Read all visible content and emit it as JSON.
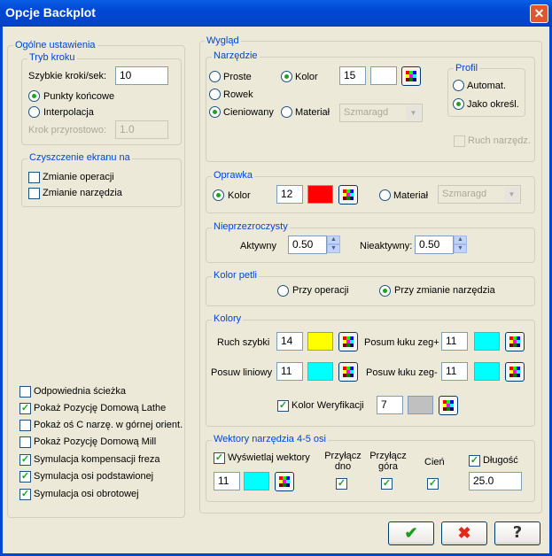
{
  "window": {
    "title": "Opcje Backplot"
  },
  "general": {
    "legend": "Ogólne ustawienia",
    "step_mode": {
      "legend": "Tryb kroku",
      "fast_steps_label": "Szybkie kroki/sek:",
      "fast_steps_value": "10",
      "endpoints_label": "Punkty końcowe",
      "interpolation_label": "Interpolacja",
      "increment_label": "Krok przyrostowo:",
      "increment_value": "1.0"
    },
    "clear_screen": {
      "legend": "Czyszczenie ekranu na",
      "op_change": "Zmianie operacji",
      "tool_change": "Zmianie narzędzia"
    },
    "options": [
      {
        "label": "Odpowiednia ścieżka",
        "checked": false
      },
      {
        "label": "Pokaż Pozycję Domową Lathe",
        "checked": true
      },
      {
        "label": "Pokaż oś C narzę. w górnej orient.",
        "checked": false
      },
      {
        "label": "Pokaż Pozycję Domową Mill",
        "checked": false
      },
      {
        "label": "Symulacja kompensacji freza",
        "checked": true
      },
      {
        "label": "Symulacja osi podstawionej",
        "checked": true
      },
      {
        "label": "Symulacja osi obrotowej",
        "checked": true
      }
    ]
  },
  "appearance": {
    "legend": "Wygląd",
    "tool": {
      "legend": "Narzędzie",
      "plain": "Proste",
      "line": "Rowek",
      "shaded": "Cieniowany",
      "color_label": "Kolor",
      "color_value": "15",
      "material_label": "Materiał",
      "material_value": "Szmaragd",
      "profile": {
        "legend": "Profil",
        "auto": "Automat.",
        "as_defined": "Jako określ."
      },
      "tool_motion": "Ruch narzędz."
    },
    "holder": {
      "legend": "Oprawka",
      "color_label": "Kolor",
      "color_value": "12",
      "material_label": "Materiał",
      "material_value": "Szmaragd"
    },
    "opacity": {
      "legend": "Nieprzezroczysty",
      "active_label": "Aktywny",
      "active_value": "0.50",
      "inactive_label": "Nieaktywny:",
      "inactive_value": "0.50"
    },
    "loop_color": {
      "legend": "Kolor petli",
      "per_op": "Przy operacji",
      "per_tool": "Przy zmianie narzędzia"
    },
    "colors": {
      "legend": "Kolory",
      "rapid_label": "Ruch szybki",
      "rapid_value": "14",
      "arc_cw_label": "Posum łuku zeg+",
      "arc_cw_value": "11",
      "linear_label": "Posuw liniowy",
      "linear_value": "11",
      "arc_ccw_label": "Posuw łuku zeg-",
      "arc_ccw_value": "11",
      "verify_label": "Kolor Weryfikacji",
      "verify_value": "7"
    },
    "vectors": {
      "legend": "Wektory narzędzia 4-5 osi",
      "show_label": "Wyświetlaj wektory",
      "color_value": "11",
      "attach_bottom": [
        "Przyłącz",
        "dno"
      ],
      "attach_top": [
        "Przyłącz",
        "góra"
      ],
      "shade": "Cień",
      "length_label": "Długość",
      "length_value": "25.0"
    }
  },
  "buttons": {
    "ok": "✔",
    "cancel": "✖",
    "help": "?"
  },
  "colors_hex": {
    "yellow": "#ffff00",
    "cyan": "#00ffff",
    "red": "#ff0000",
    "white": "#ffffff",
    "gray": "#c0c0c0",
    "accent": "#0046d5"
  }
}
